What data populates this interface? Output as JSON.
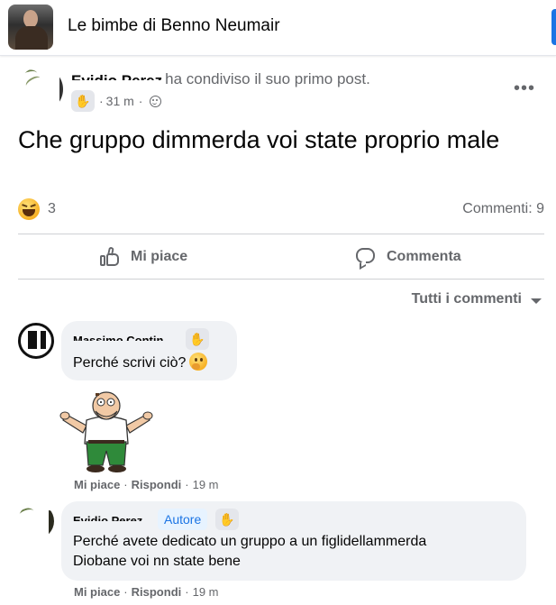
{
  "header": {
    "group_name": "Le bimbe di Benno Neumair"
  },
  "post": {
    "author_name": "Evidio Perez",
    "shared_text": "ha condiviso il suo primo post.",
    "time": "31 m",
    "text": "Che gruppo dimmerda voi state proprio male",
    "reaction_count": "3",
    "comments_label": "Commenti: 9",
    "like_label": "Mi piace",
    "comment_label": "Commenta",
    "sort_label": "Tutti i commenti"
  },
  "comments": [
    {
      "author": "Massimo Contin",
      "text": "Perché scrivi ciò?",
      "like": "Mi piace",
      "reply": "Rispondi",
      "time": "19 m"
    },
    {
      "author": "Evidio Perez",
      "tag": "Autore",
      "line1": "Perché avete dedicato un gruppo a un figlidellammerda",
      "line2": "Diobane voi nn state bene",
      "like": "Mi piace",
      "reply": "Rispondi",
      "time": "19 m"
    }
  ],
  "colors": {
    "accent": "#1b74e4",
    "secondary_text": "#65676b",
    "bubble": "#f0f2f5"
  }
}
